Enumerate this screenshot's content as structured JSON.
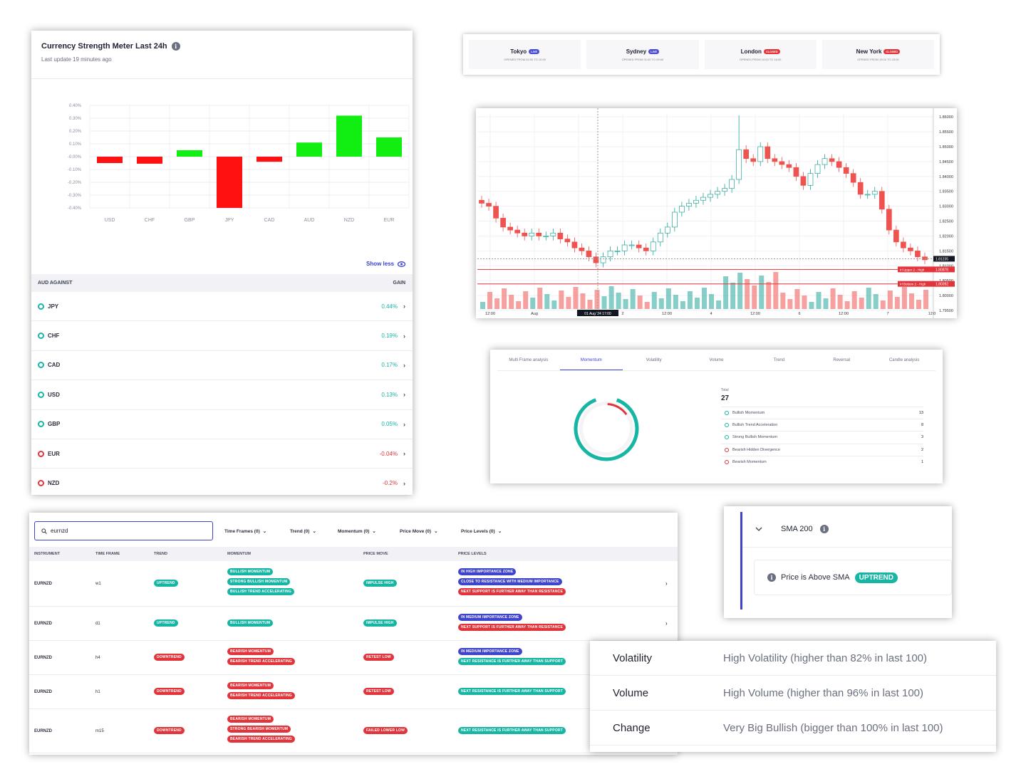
{
  "csm": {
    "title": "Currency Strength Meter Last 24h",
    "subtitle": "Last update 19 minutes ago",
    "show_less": "Show less",
    "col_left": "AUD AGAINST",
    "col_right": "GAIN",
    "rows": [
      {
        "currency": "JPY",
        "gain": "0.44%",
        "positive": true
      },
      {
        "currency": "CHF",
        "gain": "0.19%",
        "positive": true
      },
      {
        "currency": "CAD",
        "gain": "0.17%",
        "positive": true
      },
      {
        "currency": "USD",
        "gain": "0.13%",
        "positive": true
      },
      {
        "currency": "GBP",
        "gain": "0.05%",
        "positive": true
      },
      {
        "currency": "EUR",
        "gain": "-0.04%",
        "positive": false
      },
      {
        "currency": "NZD",
        "gain": "-0.2%",
        "positive": false
      }
    ]
  },
  "chart_data": [
    {
      "type": "bar",
      "categories": [
        "USD",
        "CHF",
        "GBP",
        "JPY",
        "CAD",
        "AUD",
        "NZD",
        "EUR"
      ],
      "values": [
        -0.05,
        -0.055,
        0.05,
        -0.4,
        -0.04,
        0.11,
        0.32,
        0.15
      ],
      "yticks": [
        "0.40%",
        "0.30%",
        "0.20%",
        "0.10%",
        "-0.00%",
        "-0.10%",
        "-0.20%",
        "-0.30%",
        "-0.40%"
      ],
      "ylim": [
        -0.4,
        0.4
      ],
      "grid": true,
      "colors": {
        "positive": "#11ee11",
        "negative": "#ff1111"
      }
    },
    {
      "type": "line",
      "x_labels": [
        "12:00",
        "Aug",
        "12",
        "2",
        "12:00",
        "4",
        "12:00",
        "6",
        "12:00",
        "7",
        "12:0"
      ],
      "crosshair_x_label": "01 Aug '24 17:00",
      "yticks": [
        "1.86000",
        "1.85500",
        "1.85000",
        "1.84500",
        "1.84000",
        "1.83500",
        "1.83000",
        "1.82500",
        "1.82000",
        "1.81500",
        "1.81000",
        "1.80500",
        "1.80000",
        "1.79500"
      ],
      "ylim": [
        1.795,
        1.861
      ],
      "last_price": "1.81235",
      "levels": [
        {
          "name": "Irl Upper 2 - High",
          "value": "1.80878",
          "y": 1.80878
        },
        {
          "name": "Irl Bottom 2 - High",
          "value": "1.80392",
          "y": 1.80392
        }
      ],
      "close": [
        1.831,
        1.83,
        1.826,
        1.823,
        1.822,
        1.821,
        1.82,
        1.821,
        1.82,
        1.82,
        1.821,
        1.819,
        1.818,
        1.816,
        1.815,
        1.813,
        1.811,
        1.813,
        1.815,
        1.815,
        1.817,
        1.817,
        1.816,
        1.815,
        1.818,
        1.821,
        1.823,
        1.828,
        1.83,
        1.831,
        1.832,
        1.833,
        1.834,
        1.835,
        1.836,
        1.839,
        1.849,
        1.846,
        1.845,
        1.85,
        1.846,
        1.845,
        1.844,
        1.843,
        1.84,
        1.837,
        1.841,
        1.844,
        1.846,
        1.845,
        1.843,
        1.841,
        1.838,
        1.834,
        1.834,
        1.835,
        1.829,
        1.822,
        1.818,
        1.816,
        1.815,
        1.813,
        1.812
      ],
      "colors": {
        "up": "#26a69a",
        "down": "#ef5350"
      }
    },
    {
      "type": "pie",
      "labels": [
        "Bullish Momentum",
        "Bullish Trend Acceleration",
        "Strong Bullish Momentum",
        "Bearish Hidden Divergence",
        "Bearish Momentum"
      ],
      "values": [
        13,
        8,
        3,
        2,
        1
      ],
      "total": 27,
      "colors": {
        "bullish": "#17b6a4",
        "bearish": "#e2353b"
      }
    }
  ],
  "sessions": [
    {
      "name": "Tokyo",
      "status": "LIVE",
      "live": true,
      "hours": "OPENED FROM 02:00 TO 10:00"
    },
    {
      "name": "Sydney",
      "status": "LIVE",
      "live": true,
      "hours": "OPENED FROM 01:00 TO 09:00"
    },
    {
      "name": "London",
      "status": "CLOSED",
      "live": false,
      "hours": "OPENED FROM 10:00 TO 18:00"
    },
    {
      "name": "New York",
      "status": "CLOSED",
      "live": false,
      "hours": "OPENED FROM 15:00 TO 23:00"
    }
  ],
  "momentum": {
    "tabs": [
      "Multi Frame analysis",
      "Momentum",
      "Volatility",
      "Volume",
      "Trend",
      "Reversal",
      "Candle analysis"
    ],
    "active_tab": 1,
    "total_label": "Total",
    "total_value": "27",
    "items": [
      {
        "label": "Bullish Momentum",
        "count": "13",
        "bullish": true
      },
      {
        "label": "Bullish Trend Acceleration",
        "count": "8",
        "bullish": true
      },
      {
        "label": "Strong Bullish Momentum",
        "count": "3",
        "bullish": true
      },
      {
        "label": "Bearish Hidden Divergence",
        "count": "2",
        "bullish": false
      },
      {
        "label": "Bearish Momentum",
        "count": "1",
        "bullish": false
      }
    ]
  },
  "screener": {
    "search_value": "eurnzd",
    "filters": [
      "Time Frames (0)",
      "Trend (0)",
      "Momentum (0)",
      "Price Move (0)",
      "Price Levels (0)"
    ],
    "columns": [
      "INSTRUMENT",
      "TIME FRAME",
      "TREND",
      "MOMENTUM",
      "PRICE MOVE",
      "PRICE LEVELS"
    ],
    "rows": [
      {
        "instrument": "EURNZD",
        "timeframe": "w1",
        "trend": {
          "label": "UPTREND",
          "color": "teal"
        },
        "momentum": [
          {
            "label": "BULLISH MOMENTUM",
            "color": "teal"
          },
          {
            "label": "STRONG BULLISH MOMENTUM",
            "color": "teal"
          },
          {
            "label": "BULLISH TREND ACCELERATING",
            "color": "teal"
          }
        ],
        "price_move": {
          "label": "IMPULSE HIGH",
          "color": "teal"
        },
        "levels": [
          {
            "label": "IN HIGH IMPORTANCE ZONE",
            "color": "blue"
          },
          {
            "label": "CLOSE TO RESISTANCE WITH MEDIUM IMPORTANCE",
            "color": "blue"
          },
          {
            "label": "NEXT SUPPORT IS FURTHER AWAY THAN RESISTANCE",
            "color": "red"
          }
        ]
      },
      {
        "instrument": "EURNZD",
        "timeframe": "d1",
        "trend": {
          "label": "UPTREND",
          "color": "teal"
        },
        "momentum": [
          {
            "label": "BULLISH MOMENTUM",
            "color": "teal"
          }
        ],
        "price_move": {
          "label": "IMPULSE HIGH",
          "color": "teal"
        },
        "levels": [
          {
            "label": "IN MEDIUM IMPORTANCE ZONE",
            "color": "blue"
          },
          {
            "label": "NEXT SUPPORT IS FURTHER AWAY THAN RESISTANCE",
            "color": "red"
          }
        ]
      },
      {
        "instrument": "EURNZD",
        "timeframe": "h4",
        "trend": {
          "label": "DOWNTREND",
          "color": "red"
        },
        "momentum": [
          {
            "label": "BEARISH MOMENTUM",
            "color": "red"
          },
          {
            "label": "BEARISH TREND ACCELERATING",
            "color": "red"
          }
        ],
        "price_move": {
          "label": "RETEST LOW",
          "color": "red"
        },
        "levels": [
          {
            "label": "IN MEDIUM IMPORTANCE ZONE",
            "color": "blue"
          },
          {
            "label": "NEXT RESISTANCE IS FURTHER AWAY THAN SUPPORT",
            "color": "teal"
          }
        ]
      },
      {
        "instrument": "EURNZD",
        "timeframe": "h1",
        "trend": {
          "label": "DOWNTREND",
          "color": "red"
        },
        "momentum": [
          {
            "label": "BEARISH MOMENTUM",
            "color": "red"
          },
          {
            "label": "BEARISH TREND ACCELERATING",
            "color": "red"
          }
        ],
        "price_move": {
          "label": "RETEST LOW",
          "color": "red"
        },
        "levels": [
          {
            "label": "NEXT RESISTANCE IS FURTHER AWAY THAN SUPPORT",
            "color": "teal"
          }
        ]
      },
      {
        "instrument": "EURNZD",
        "timeframe": "m15",
        "trend": {
          "label": "DOWNTREND",
          "color": "red"
        },
        "momentum": [
          {
            "label": "BEARISH MOMENTUM",
            "color": "red"
          },
          {
            "label": "STRONG BEARISH MOMENTUM",
            "color": "red"
          },
          {
            "label": "BEARISH TREND ACCELERATING",
            "color": "red"
          }
        ],
        "price_move": {
          "label": "FAILED LOWER LOW",
          "color": "red"
        },
        "levels": [
          {
            "label": "NEXT RESISTANCE IS FURTHER AWAY THAN SUPPORT",
            "color": "teal"
          }
        ]
      }
    ]
  },
  "sma": {
    "title": "SMA 200",
    "message": "Price is Above SMA",
    "badge": "UPTREND"
  },
  "stats": [
    {
      "key": "Volatility",
      "value": "High Volatility (higher than 82% in last 100)"
    },
    {
      "key": "Volume",
      "value": "High Volume (higher than 96% in last 100)"
    },
    {
      "key": "Change",
      "value": "Very Big Bullish (bigger than 100% in last 100)"
    }
  ]
}
